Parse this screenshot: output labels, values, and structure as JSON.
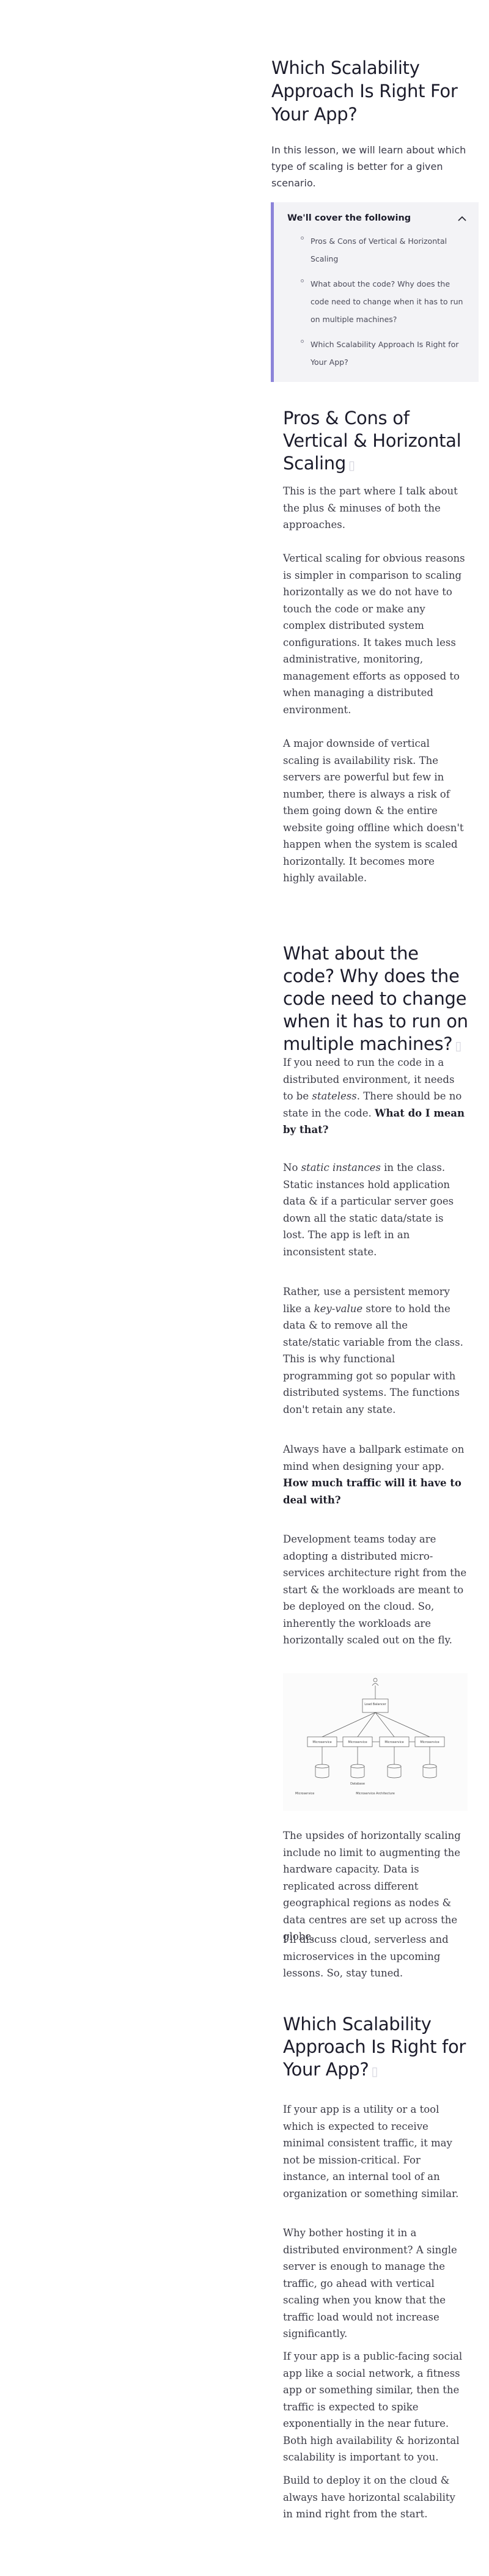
{
  "lesson": {
    "title": "Which Scalability Approach Is Right For Your App?",
    "intro": "In this lesson, we will learn about which type of scaling is better for a given scenario."
  },
  "toc": {
    "heading": "We'll cover the following",
    "items": [
      "Pros & Cons of Vertical & Horizontal Scaling",
      "What about the code? Why does the code need to change when it has to run on multiple machines?",
      "Which Scalability Approach Is Right for Your App?"
    ]
  },
  "sections": {
    "pros_cons": {
      "heading": "Pros & Cons of Vertical & Horizontal Scaling",
      "p1": "This is the part where I talk about the plus & minuses of both the approaches.",
      "p2": "Vertical scaling for obvious reasons is simpler in comparison to scaling horizontally as we do not have to touch the code or make any complex distributed system configurations. It takes much less administrative, monitoring, management efforts as opposed to when managing a distributed environment.",
      "p3": "A major downside of vertical scaling is availability risk. The servers are powerful but few in number, there is always a risk of them going down & the entire website going offline which doesn't happen when the system is scaled horizontally. It becomes more highly available."
    },
    "code": {
      "heading": "What about the code? Why does the code need to change when it has to run on multiple machines?",
      "p1_a": "If you need to run the code in a distributed environment, it needs to be ",
      "p1_em": "stateless",
      "p1_b": ". There should be no state in the code. ",
      "p1_strong": "What do I mean by that?",
      "p2_a": "No ",
      "p2_em": "static instances",
      "p2_b": " in the class. Static instances hold application data & if a particular server goes down all the static data/state is lost. The app is left in an inconsistent state.",
      "p3_a": "Rather, use a persistent memory like a ",
      "p3_em": "key-value",
      "p3_b": " store to hold the data & to remove all the state/static variable from the class. This is why functional programming got so popular with distributed systems. The functions don't retain any state.",
      "p4_a": "Always have a ballpark estimate on mind when designing your app. ",
      "p4_strong": "How much traffic will it have to deal with?",
      "p5": "Development teams today are adopting a distributed micro-services architecture right from the start & the workloads are meant to be deployed on the cloud. So, inherently the workloads are horizontally scaled out on the fly.",
      "p6": "The upsides of horizontally scaling include no limit to augmenting the hardware capacity. Data is replicated across different geographical regions as nodes & data centres are set up across the globe.",
      "p7": "I'll discuss cloud, serverless and microservices in the upcoming lessons. So, stay tuned."
    },
    "which": {
      "heading": "Which Scalability Approach Is Right for Your App?",
      "p1": "If your app is a utility or a tool which is expected to receive minimal consistent traffic, it may not be mission-critical. For instance, an internal tool of an organization or something similar.",
      "p2": "Why bother hosting it in a distributed environment? A single server is enough to manage the traffic, go ahead with vertical scaling when you know that the traffic load would not increase significantly.",
      "p3": "If your app is a public-facing social app like a social network, a fitness app or something similar, then the traffic is expected to spike exponentially in the near future. Both high availability & horizontal scalability is important to you.",
      "p4": "Build to deploy it on the cloud & always have horizontal scalability in mind right from the start."
    }
  },
  "diagram": {
    "top_label": "Load\nBalancer",
    "node_label": "Microservice",
    "db_label": "Database",
    "bottom_left": "Microservice",
    "bottom_center": "Microservice Architecture"
  },
  "colors": {
    "accent": "#8c84d9",
    "toc_bg": "#f3f3f6",
    "heading": "#1c1c2b",
    "body_text": "#3b3b46"
  },
  "icons": {
    "toc_toggle": "chevron-up-icon",
    "heading_anchor": "link-icon"
  }
}
